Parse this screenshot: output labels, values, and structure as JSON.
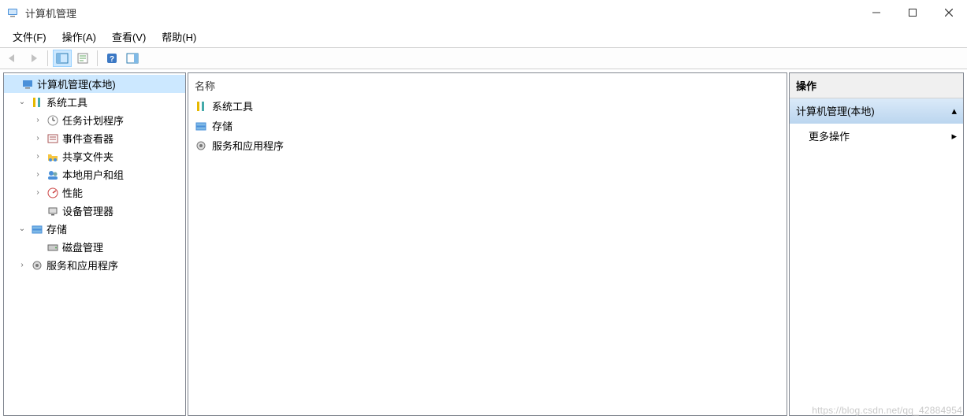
{
  "window": {
    "title": "计算机管理"
  },
  "menu": {
    "file": "文件(F)",
    "action": "操作(A)",
    "view": "查看(V)",
    "help": "帮助(H)"
  },
  "tree": {
    "root": "计算机管理(本地)",
    "system_tools": "系统工具",
    "task_scheduler": "任务计划程序",
    "event_viewer": "事件查看器",
    "shared_folders": "共享文件夹",
    "local_users_groups": "本地用户和组",
    "performance": "性能",
    "device_manager": "设备管理器",
    "storage": "存储",
    "disk_management": "磁盘管理",
    "services_apps": "服务和应用程序"
  },
  "list": {
    "header_name": "名称",
    "items": [
      "系统工具",
      "存储",
      "服务和应用程序"
    ]
  },
  "actions": {
    "header": "操作",
    "group_title": "计算机管理(本地)",
    "more": "更多操作"
  },
  "watermark": "https://blog.csdn.net/qq_42884954"
}
